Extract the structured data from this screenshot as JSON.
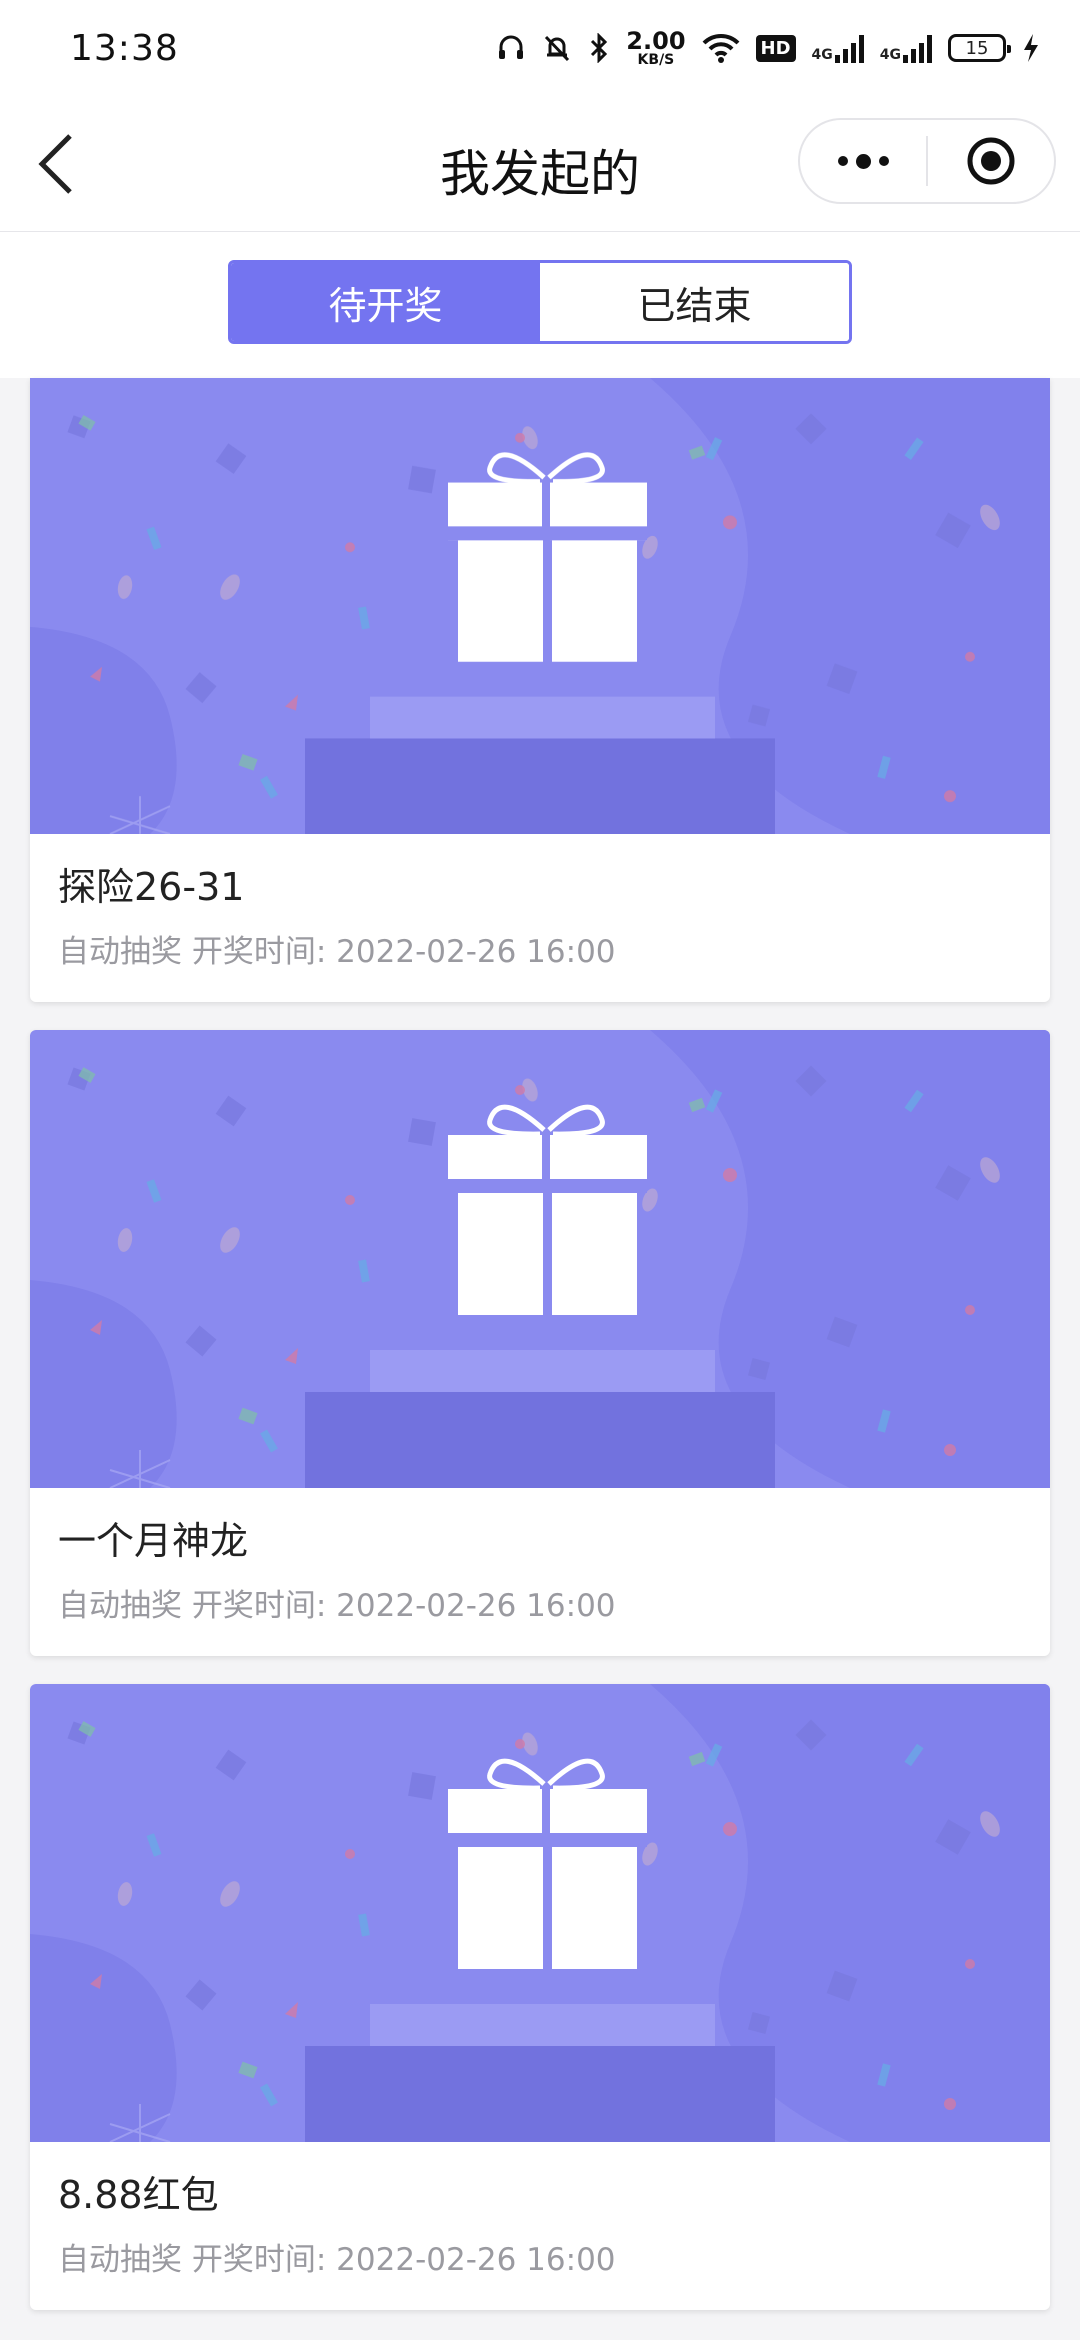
{
  "status_bar": {
    "time": "13:38",
    "speed_value": "2.00",
    "speed_unit": "KB/S",
    "hd_label": "HD",
    "net1": "4G",
    "net2": "4G",
    "battery": "15",
    "icons": [
      "headphones-icon",
      "mute-bell-icon",
      "bluetooth-icon",
      "wifi-icon",
      "signal-icon",
      "charging-icon"
    ]
  },
  "nav": {
    "title": "我发起的",
    "back_icon": "chevron-left-icon",
    "more_icon": "more-dots-icon",
    "close_icon": "target-circle-icon"
  },
  "tabs": [
    {
      "label": "待开奖",
      "active": true
    },
    {
      "label": "已结束",
      "active": false
    }
  ],
  "colors": {
    "accent": "#7474f0",
    "banner_bg": "#8a8aef",
    "meta_text": "#9a9aa0"
  },
  "cards": [
    {
      "title": "探险26-31",
      "mode": "自动抽奖",
      "time_label": "开奖时间:",
      "time": "2022-02-26 16:00"
    },
    {
      "title": "一个月神龙",
      "mode": "自动抽奖",
      "time_label": "开奖时间:",
      "time": "2022-02-26 16:00"
    },
    {
      "title": "8.88红包",
      "mode": "自动抽奖",
      "time_label": "开奖时间:",
      "time": "2022-02-26 16:00"
    }
  ]
}
